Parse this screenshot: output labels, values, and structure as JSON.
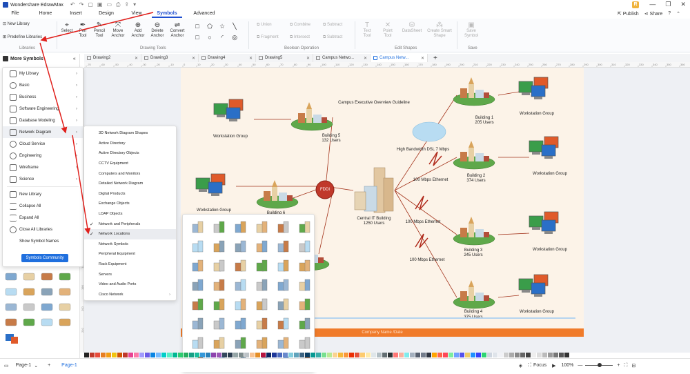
{
  "app": {
    "title": "Wondershare EdrawMax",
    "user_initial": "R"
  },
  "menu": {
    "items": [
      "File",
      "Home",
      "Insert",
      "Design",
      "View",
      "Symbols",
      "Advanced"
    ],
    "active": "Symbols",
    "publish": "Publish",
    "share": "Share"
  },
  "ribbon": {
    "libraries": {
      "new_library": "New Library",
      "predefine": "Predefine Libraries",
      "label": "Libraries"
    },
    "drawing_tools": {
      "select": "Select",
      "pen": "Pen Tool",
      "pencil": "Pencil Tool",
      "move_anchor": "Move Anchor",
      "add_anchor": "Add Anchor",
      "delete_anchor": "Delete Anchor",
      "convert_anchor": "Convert Anchor",
      "label": "Drawing Tools"
    },
    "boolean": {
      "union": "Union",
      "combine": "Combine",
      "subtract": "Subtract",
      "fragment": "Fragment",
      "intersect": "Intersect",
      "subtract2": "Subtract",
      "label": "Boolean Operation"
    },
    "edit_shapes": {
      "text": "Text Tool",
      "point": "Point Tool",
      "datasheet": "DataSheet",
      "smart": "Create Smart Shape",
      "label": "Edit Shapes"
    },
    "save": {
      "save_symbol": "Save Symbol",
      "label": "Save"
    }
  },
  "tabs": [
    {
      "label": "Drawing2",
      "active": false
    },
    {
      "label": "Drawing3",
      "active": false
    },
    {
      "label": "Drawing4",
      "active": false
    },
    {
      "label": "Drawing5",
      "active": false
    },
    {
      "label": "Campus Netwo...",
      "active": false
    },
    {
      "label": "Campus Netw...",
      "active": true
    }
  ],
  "ruler_top": [
    "-70",
    "-60",
    "-50",
    "-40",
    "-30",
    "-20",
    "-10",
    "0",
    "10",
    "20",
    "30",
    "40",
    "50",
    "60",
    "70",
    "80",
    "90",
    "100",
    "110",
    "120",
    "130",
    "140",
    "150",
    "160",
    "170",
    "180",
    "190",
    "200",
    "210",
    "220",
    "230",
    "240",
    "250",
    "260",
    "270",
    "280",
    "290",
    "300",
    "310",
    "320",
    "330",
    "340",
    "350",
    "360"
  ],
  "ruler_left": [
    "90",
    "100",
    "110",
    "120",
    "130",
    "140",
    "150",
    "160",
    "170",
    "180",
    "190",
    "200",
    "210"
  ],
  "left_panel": {
    "header": "More Symbols"
  },
  "symbols_menu": {
    "items": [
      {
        "label": "My Library",
        "chevron": true
      },
      {
        "label": "Basic",
        "chevron": true
      },
      {
        "label": "Business",
        "chevron": true
      },
      {
        "label": "Software Engineering",
        "chevron": true
      },
      {
        "label": "Database Modeling",
        "chevron": true
      },
      {
        "label": "Network Diagram",
        "chevron": true,
        "highlighted": true
      },
      {
        "label": "Cloud Service",
        "chevron": true
      },
      {
        "label": "Engineering",
        "chevron": true
      },
      {
        "label": "Wireframe",
        "chevron": true
      },
      {
        "label": "Science",
        "chevron": true
      }
    ],
    "actions": [
      "New Library",
      "Collapse All",
      "Expand All",
      "Close All Libraries",
      "Show Symbol Names"
    ],
    "community": "Symbols Community"
  },
  "network_submenu": [
    {
      "label": "3D Network Diagram Shapes",
      "checked": false
    },
    {
      "label": "Active Directory",
      "checked": false
    },
    {
      "label": "Active Directory Objects",
      "checked": false
    },
    {
      "label": "CCTV Equipment",
      "checked": false
    },
    {
      "label": "Computers and Monitors",
      "checked": false
    },
    {
      "label": "Detailed Network Diagram",
      "checked": false
    },
    {
      "label": "Digital Products",
      "checked": false
    },
    {
      "label": "Exchange Objects",
      "checked": false
    },
    {
      "label": "LDAP Objects",
      "checked": false
    },
    {
      "label": "Network and Peripherals",
      "checked": true
    },
    {
      "label": "Network Locations",
      "checked": true,
      "highlighted": true
    },
    {
      "label": "Network Symbols",
      "checked": false
    },
    {
      "label": "Peripheral Equipment",
      "checked": false
    },
    {
      "label": "Rack Equipment",
      "checked": false
    },
    {
      "label": "Servers",
      "checked": false
    },
    {
      "label": "Video and Audio Ports",
      "checked": false
    },
    {
      "label": "Cisco Network",
      "checked": false,
      "chevron": true
    }
  ],
  "diagram": {
    "title": "Campus Executive Overview Guideline",
    "footer": "Company Name /Date",
    "fddi": "FDDI",
    "central": [
      "Central IT Building",
      "1250 Users"
    ],
    "dsl": "High Bandwidth DSL 7 Mbps",
    "eth1": "100 Mbps Ethernet",
    "eth2": "100 Mbps Ethernet",
    "eth3": "100 Mbps Ethernet",
    "buildings": [
      {
        "name": "Building 1",
        "users": "205 Users"
      },
      {
        "name": "Building 2",
        "users": "374 Users"
      },
      {
        "name": "Building 3",
        "users": "245 Users"
      },
      {
        "name": "Building 4",
        "users": "375 Users"
      },
      {
        "name": "Building 5",
        "users": "132 Users"
      },
      {
        "name": "Building 6",
        "users": ""
      }
    ],
    "workstation": "Workstation Group"
  },
  "status": {
    "page": "Page-1",
    "page_tab": "Page-1",
    "focus": "Focus",
    "zoom": "100%"
  },
  "colors": {
    "accent": "#1f4fd0",
    "canvas": "#fcf3e8",
    "footer": "#f07b2a",
    "fddi": "#c0392b"
  }
}
